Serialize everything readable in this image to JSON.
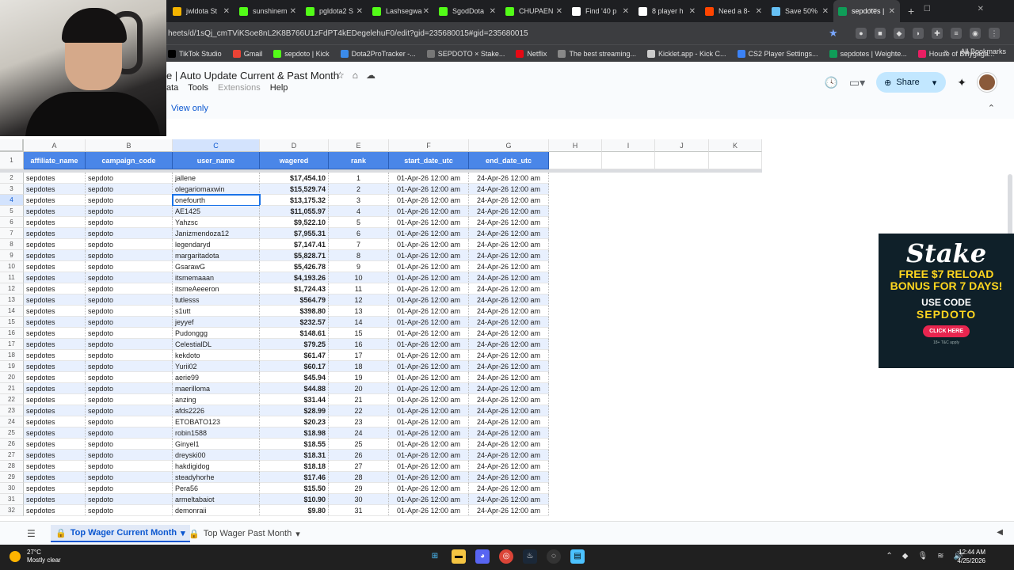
{
  "browser": {
    "tabs": [
      {
        "label": "jwldota St",
        "color": "#f4b400"
      },
      {
        "label": "sunshinem",
        "color": "#53fc18"
      },
      {
        "label": "pgldota2 S",
        "color": "#53fc18"
      },
      {
        "label": "Lashsegwa",
        "color": "#53fc18"
      },
      {
        "label": "SgodDota",
        "color": "#53fc18"
      },
      {
        "label": "CHUPAEN",
        "color": "#53fc18"
      },
      {
        "label": "Find '40 p",
        "color": "#ffffff"
      },
      {
        "label": "8 player h",
        "color": "#ffffff"
      },
      {
        "label": "Need a 8-",
        "color": "#ff4500"
      },
      {
        "label": "Save 50%",
        "color": "#66c0f4"
      },
      {
        "label": "sepdotes |",
        "color": "#0f9d58"
      }
    ],
    "url": "heets/d/1sQj_cmTViKSoe8nL2K8B766U1zFdPT4kEDegelehuF0/edit?gid=235680015#gid=235680015",
    "bookmarks": [
      "TikTok Studio",
      "Gmail",
      "sepdoto | Kick",
      "Dota2ProTracker -...",
      "SEPDOTO × Stake...",
      "Netflix",
      "The best streaming...",
      "Kicklet.app - Kick C...",
      "CS2 Player Settings...",
      "sepdotes | Weighte...",
      "House of Billygaga..."
    ],
    "all_bookmarks": "All Bookmarks"
  },
  "doc": {
    "title": "e | Auto Update Current & Past Month",
    "menus": [
      "ata",
      "Tools",
      "Extensions",
      "Help"
    ],
    "share_label": "Share",
    "view_only": "View only"
  },
  "columns": [
    "A",
    "B",
    "C",
    "D",
    "E",
    "F",
    "G",
    "H",
    "I",
    "J",
    "K"
  ],
  "table": {
    "headers": [
      "affiliate_name",
      "campaign_code",
      "user_name",
      "wagered",
      "rank",
      "start_date_utc",
      "end_date_utc"
    ],
    "rows": [
      [
        "sepdotes",
        "sepdoto",
        "jallene",
        "$17,454.10",
        "1",
        "01-Apr-26 12:00 am",
        "24-Apr-26 12:00 am"
      ],
      [
        "sepdotes",
        "sepdoto",
        "olegariomaxwin",
        "$15,529.74",
        "2",
        "01-Apr-26 12:00 am",
        "24-Apr-26 12:00 am"
      ],
      [
        "sepdotes",
        "sepdoto",
        "onefourth",
        "$13,175.32",
        "3",
        "01-Apr-26 12:00 am",
        "24-Apr-26 12:00 am"
      ],
      [
        "sepdotes",
        "sepdoto",
        "AE1425",
        "$11,055.97",
        "4",
        "01-Apr-26 12:00 am",
        "24-Apr-26 12:00 am"
      ],
      [
        "sepdotes",
        "sepdoto",
        "Yahzsc",
        "$9,522.10",
        "5",
        "01-Apr-26 12:00 am",
        "24-Apr-26 12:00 am"
      ],
      [
        "sepdotes",
        "sepdoto",
        "Janizmendoza12",
        "$7,955.31",
        "6",
        "01-Apr-26 12:00 am",
        "24-Apr-26 12:00 am"
      ],
      [
        "sepdotes",
        "sepdoto",
        "legendaryd",
        "$7,147.41",
        "7",
        "01-Apr-26 12:00 am",
        "24-Apr-26 12:00 am"
      ],
      [
        "sepdotes",
        "sepdoto",
        "margaritadota",
        "$5,828.71",
        "8",
        "01-Apr-26 12:00 am",
        "24-Apr-26 12:00 am"
      ],
      [
        "sepdotes",
        "sepdoto",
        "GsarawG",
        "$5,426.78",
        "9",
        "01-Apr-26 12:00 am",
        "24-Apr-26 12:00 am"
      ],
      [
        "sepdotes",
        "sepdoto",
        "itsmemaaan",
        "$4,193.26",
        "10",
        "01-Apr-26 12:00 am",
        "24-Apr-26 12:00 am"
      ],
      [
        "sepdotes",
        "sepdoto",
        "itsmeAeeeron",
        "$1,724.43",
        "11",
        "01-Apr-26 12:00 am",
        "24-Apr-26 12:00 am"
      ],
      [
        "sepdotes",
        "sepdoto",
        "tutlesss",
        "$564.79",
        "12",
        "01-Apr-26 12:00 am",
        "24-Apr-26 12:00 am"
      ],
      [
        "sepdotes",
        "sepdoto",
        "s1utt",
        "$398.80",
        "13",
        "01-Apr-26 12:00 am",
        "24-Apr-26 12:00 am"
      ],
      [
        "sepdotes",
        "sepdoto",
        "jeyyef",
        "$232.57",
        "14",
        "01-Apr-26 12:00 am",
        "24-Apr-26 12:00 am"
      ],
      [
        "sepdotes",
        "sepdoto",
        "Pudonggg",
        "$148.61",
        "15",
        "01-Apr-26 12:00 am",
        "24-Apr-26 12:00 am"
      ],
      [
        "sepdotes",
        "sepdoto",
        "CelestialDL",
        "$79.25",
        "16",
        "01-Apr-26 12:00 am",
        "24-Apr-26 12:00 am"
      ],
      [
        "sepdotes",
        "sepdoto",
        "kekdoto",
        "$61.47",
        "17",
        "01-Apr-26 12:00 am",
        "24-Apr-26 12:00 am"
      ],
      [
        "sepdotes",
        "sepdoto",
        "Yurii02",
        "$60.17",
        "18",
        "01-Apr-26 12:00 am",
        "24-Apr-26 12:00 am"
      ],
      [
        "sepdotes",
        "sepdoto",
        "aerie99",
        "$45.94",
        "19",
        "01-Apr-26 12:00 am",
        "24-Apr-26 12:00 am"
      ],
      [
        "sepdotes",
        "sepdoto",
        "maerilloma",
        "$44.88",
        "20",
        "01-Apr-26 12:00 am",
        "24-Apr-26 12:00 am"
      ],
      [
        "sepdotes",
        "sepdoto",
        "anzing",
        "$31.44",
        "21",
        "01-Apr-26 12:00 am",
        "24-Apr-26 12:00 am"
      ],
      [
        "sepdotes",
        "sepdoto",
        "afds2226",
        "$28.99",
        "22",
        "01-Apr-26 12:00 am",
        "24-Apr-26 12:00 am"
      ],
      [
        "sepdotes",
        "sepdoto",
        "ETOBATO123",
        "$20.23",
        "23",
        "01-Apr-26 12:00 am",
        "24-Apr-26 12:00 am"
      ],
      [
        "sepdotes",
        "sepdoto",
        "robin1588",
        "$18.98",
        "24",
        "01-Apr-26 12:00 am",
        "24-Apr-26 12:00 am"
      ],
      [
        "sepdotes",
        "sepdoto",
        "Ginyel1",
        "$18.55",
        "25",
        "01-Apr-26 12:00 am",
        "24-Apr-26 12:00 am"
      ],
      [
        "sepdotes",
        "sepdoto",
        "dreyski00",
        "$18.31",
        "26",
        "01-Apr-26 12:00 am",
        "24-Apr-26 12:00 am"
      ],
      [
        "sepdotes",
        "sepdoto",
        "hakdigidog",
        "$18.18",
        "27",
        "01-Apr-26 12:00 am",
        "24-Apr-26 12:00 am"
      ],
      [
        "sepdotes",
        "sepdoto",
        "steadyhorhe",
        "$17.46",
        "28",
        "01-Apr-26 12:00 am",
        "24-Apr-26 12:00 am"
      ],
      [
        "sepdotes",
        "sepdoto",
        "Pera56",
        "$15.50",
        "29",
        "01-Apr-26 12:00 am",
        "24-Apr-26 12:00 am"
      ],
      [
        "sepdotes",
        "sepdoto",
        "armeltabaiot",
        "$10.90",
        "30",
        "01-Apr-26 12:00 am",
        "24-Apr-26 12:00 am"
      ],
      [
        "sepdotes",
        "sepdoto",
        "demonraii",
        "$9.80",
        "31",
        "01-Apr-26 12:00 am",
        "24-Apr-26 12:00 am"
      ]
    ]
  },
  "ad": {
    "logo": "Stake",
    "line1": "FREE $7 RELOAD",
    "line2": "BONUS FOR 7 DAYS!",
    "use_code": "USE CODE",
    "code": "SEPDOTO",
    "button": "CLICK HERE",
    "fine": "18+ T&C apply"
  },
  "sheets": {
    "tab1": "Top Wager Current Month",
    "tab2": "Top Wager Past Month"
  },
  "taskbar": {
    "temp": "27°C",
    "weather": "Mostly clear",
    "time": "12:44 AM",
    "date": "4/25/2026"
  },
  "colors": {
    "header_fill": "#4a86e8",
    "band_fill": "#e8f0fe",
    "accent": "#0b57d0"
  }
}
